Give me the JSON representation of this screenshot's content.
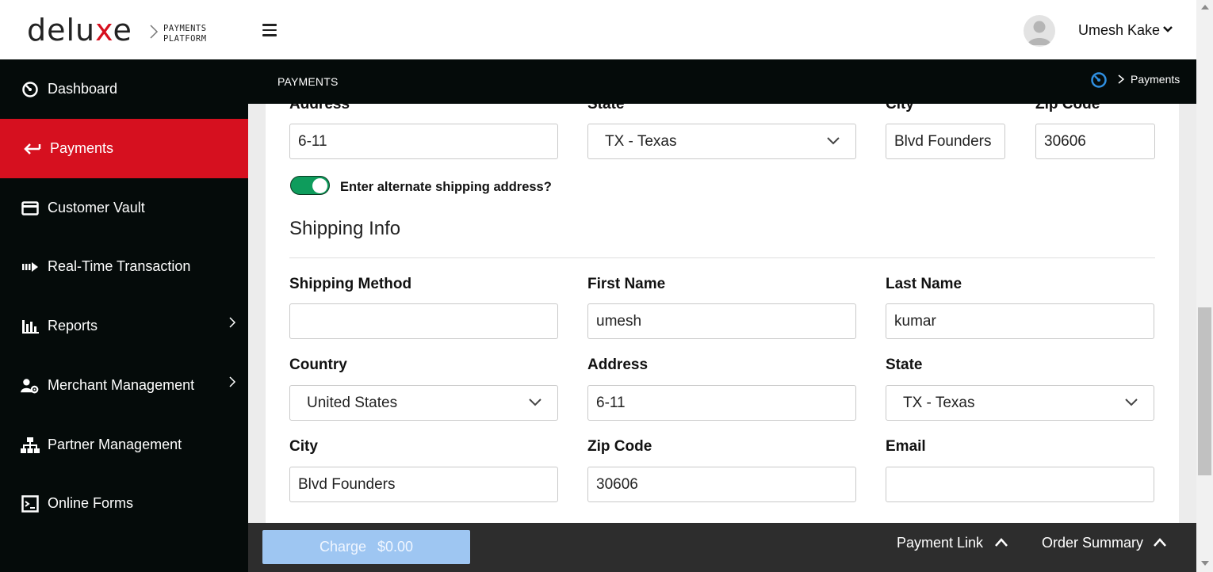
{
  "brand": {
    "name_part1": "delu",
    "name_x": "x",
    "name_part2": "e",
    "sub_line1": "PAYMENTS",
    "sub_line2": "PLATFORM",
    "accent": "#d6101f"
  },
  "header": {
    "user_name": "Umesh Kake"
  },
  "sidebar": {
    "items": [
      {
        "label": "Dashboard",
        "icon": "dashboard-gauge-icon",
        "active": false
      },
      {
        "label": "Payments",
        "icon": "arrow-back-icon",
        "active": true
      },
      {
        "label": "Customer Vault",
        "icon": "credit-card-icon",
        "active": false
      },
      {
        "label": "Real-Time Transaction",
        "icon": "fast-forward-icon",
        "active": false
      },
      {
        "label": "Reports",
        "icon": "bar-chart-icon",
        "active": false,
        "expandable": true
      },
      {
        "label": "Merchant Management",
        "icon": "user-gear-icon",
        "active": false,
        "expandable": true
      },
      {
        "label": "Partner Management",
        "icon": "org-chart-icon",
        "active": false
      },
      {
        "label": "Online Forms",
        "icon": "form-icon",
        "active": false
      }
    ]
  },
  "subheader": {
    "title": "PAYMENTS",
    "breadcrumb": "Payments"
  },
  "billing": {
    "address_label": "Address",
    "address_value": "6-11",
    "state_label": "State",
    "state_value": "TX - Texas",
    "city_label": "City",
    "city_value": "Blvd Founders",
    "zip_label": "Zip Code",
    "zip_value": "30606"
  },
  "alt_shipping": {
    "label": "Enter alternate shipping address?",
    "enabled": true
  },
  "shipping": {
    "title": "Shipping Info",
    "method_label": "Shipping Method",
    "method_value": "",
    "first_name_label": "First Name",
    "first_name_value": "umesh",
    "last_name_label": "Last Name",
    "last_name_value": "kumar",
    "country_label": "Country",
    "country_value": "United States",
    "address_label": "Address",
    "address_value": "6-11",
    "state_label": "State",
    "state_value": "TX - Texas",
    "city_label": "City",
    "city_value": "Blvd Founders",
    "zip_label": "Zip Code",
    "zip_value": "30606",
    "email_label": "Email",
    "email_value": ""
  },
  "footer": {
    "charge_label": "Charge",
    "charge_amount": "$0.00",
    "payment_link": "Payment Link",
    "order_summary": "Order Summary"
  },
  "colors": {
    "sidebar_bg": "#050b0a",
    "active_red": "#d6101f",
    "toggle_green": "#0e9c5c",
    "charge_button": "#9ec6f2",
    "footer_bg": "#2d2d2d",
    "breadcrumb_icon": "#2f8fe0"
  }
}
